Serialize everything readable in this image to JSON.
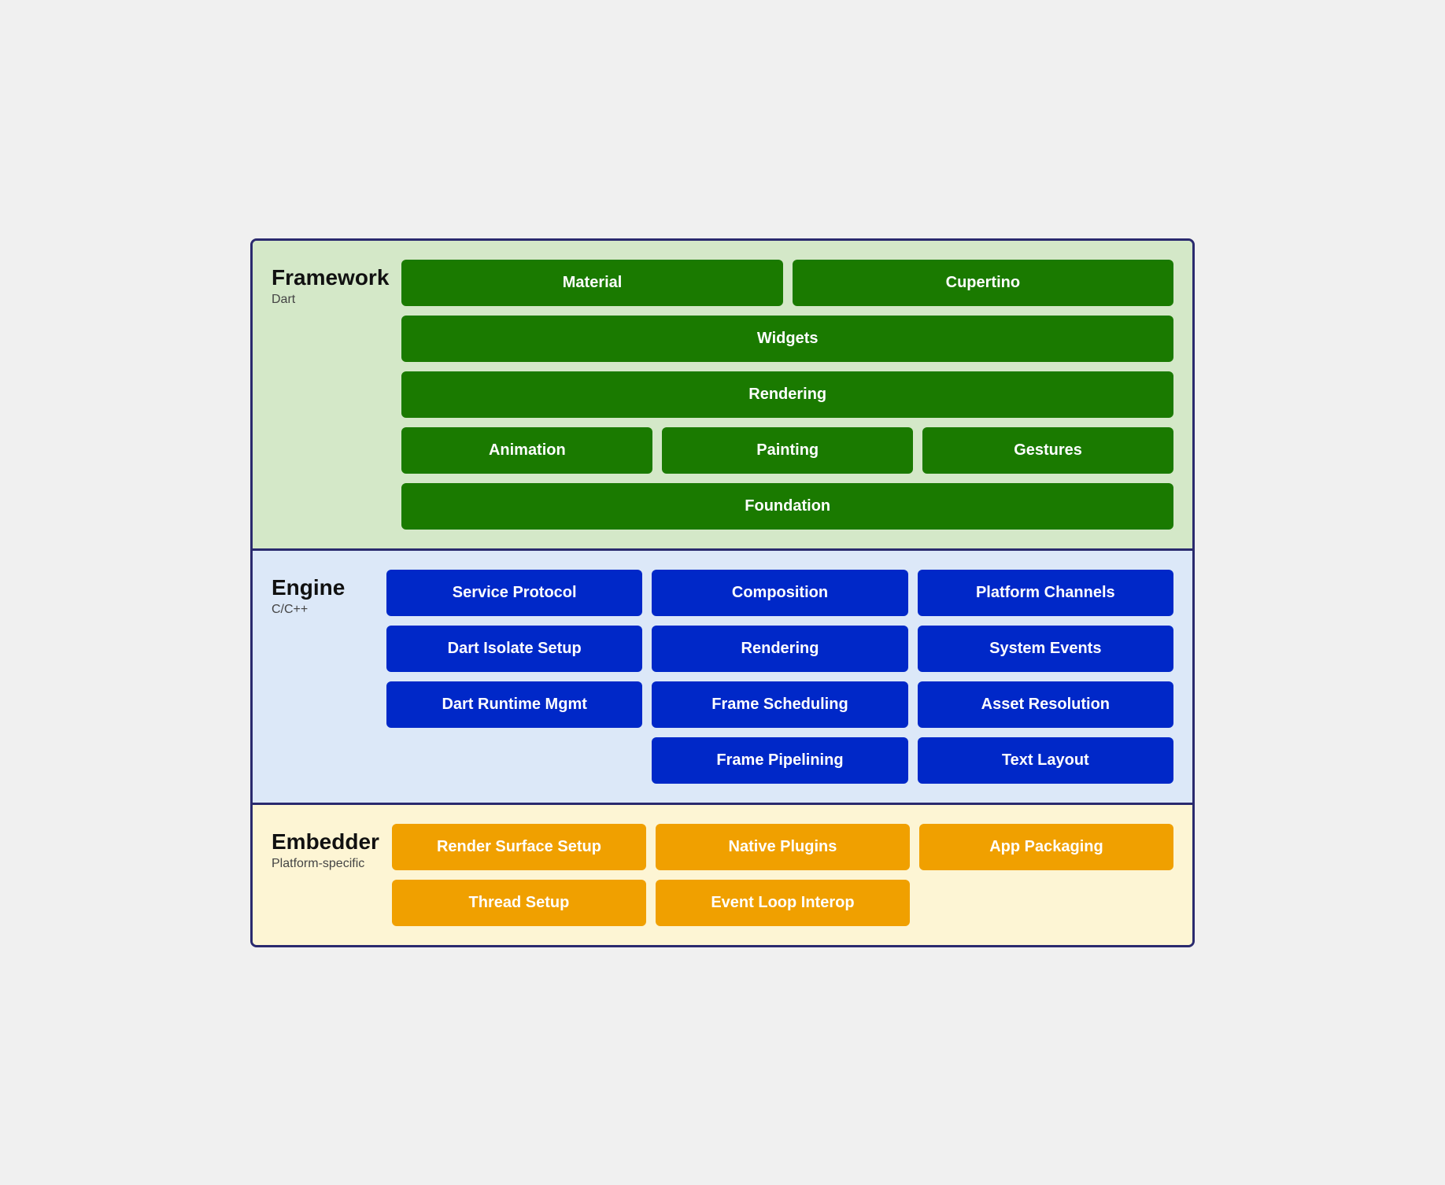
{
  "layers": [
    {
      "id": "framework",
      "title": "Framework",
      "subtitle": "Dart",
      "colorClass": "layer-framework",
      "chipClass": "chip-green",
      "rows": [
        [
          {
            "label": "Material",
            "flex": 1
          },
          {
            "label": "Cupertino",
            "flex": 1
          }
        ],
        [
          {
            "label": "Widgets",
            "flex": 1
          }
        ],
        [
          {
            "label": "Rendering",
            "flex": 1
          }
        ],
        [
          {
            "label": "Animation",
            "flex": 1
          },
          {
            "label": "Painting",
            "flex": 1
          },
          {
            "label": "Gestures",
            "flex": 1
          }
        ],
        [
          {
            "label": "Foundation",
            "flex": 1
          }
        ]
      ]
    },
    {
      "id": "engine",
      "title": "Engine",
      "subtitle": "C/C++",
      "colorClass": "layer-engine",
      "chipClass": "chip-blue",
      "rows": [
        [
          {
            "label": "Service Protocol",
            "flex": 1
          },
          {
            "label": "Composition",
            "flex": 1
          },
          {
            "label": "Platform Channels",
            "flex": 1
          }
        ],
        [
          {
            "label": "Dart Isolate Setup",
            "flex": 1
          },
          {
            "label": "Rendering",
            "flex": 1
          },
          {
            "label": "System Events",
            "flex": 1
          }
        ],
        [
          {
            "label": "Dart Runtime Mgmt",
            "flex": 1
          },
          {
            "label": "Frame Scheduling",
            "flex": 1
          },
          {
            "label": "Asset Resolution",
            "flex": 1
          }
        ],
        [
          {
            "label": "",
            "flex": 1,
            "invisible": true
          },
          {
            "label": "Frame Pipelining",
            "flex": 1
          },
          {
            "label": "Text Layout",
            "flex": 1
          }
        ]
      ]
    },
    {
      "id": "embedder",
      "title": "Embedder",
      "subtitle": "Platform-specific",
      "colorClass": "layer-embedder",
      "chipClass": "chip-orange",
      "rows": [
        [
          {
            "label": "Render Surface Setup",
            "flex": 1
          },
          {
            "label": "Native Plugins",
            "flex": 1
          },
          {
            "label": "App Packaging",
            "flex": 1
          }
        ],
        [
          {
            "label": "Thread Setup",
            "flex": 1
          },
          {
            "label": "Event Loop Interop",
            "flex": 1
          },
          {
            "label": "",
            "flex": 1,
            "invisible": true
          }
        ]
      ]
    }
  ]
}
